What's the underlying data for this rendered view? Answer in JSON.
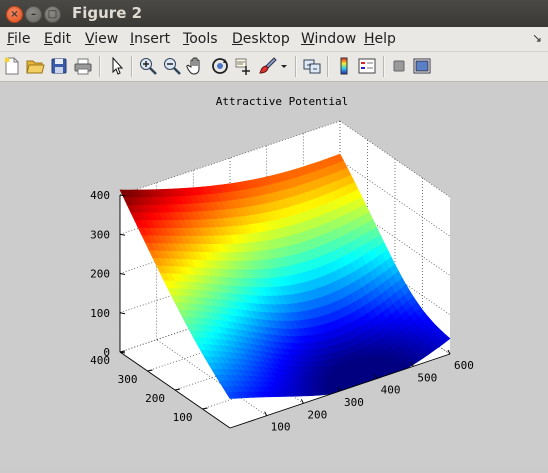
{
  "window": {
    "title": "Figure 2"
  },
  "menubar": {
    "items": [
      {
        "u": "F",
        "rest": "ile"
      },
      {
        "u": "E",
        "rest": "dit"
      },
      {
        "u": "V",
        "rest": "iew"
      },
      {
        "u": "I",
        "rest": "nsert"
      },
      {
        "u": "T",
        "rest": "ools"
      },
      {
        "u": "D",
        "rest": "esktop"
      },
      {
        "u": "W",
        "rest": "indow"
      },
      {
        "u": "H",
        "rest": "elp"
      }
    ],
    "dock_arrow": "↘"
  },
  "toolbar": {
    "icons": [
      "new-figure-icon",
      "open-file-icon",
      "save-icon",
      "print-icon",
      "edit-plot-arrow-icon",
      "zoom-in-icon",
      "zoom-out-icon",
      "pan-hand-icon",
      "rotate-3d-icon",
      "data-cursor-icon",
      "brush-icon",
      "brush-dropdown-icon",
      "link-plot-icon",
      "colorbar-icon",
      "legend-icon",
      "hide-plot-tools-icon",
      "show-plot-tools-icon"
    ]
  },
  "chart_data": {
    "type": "surface",
    "title": "Attractive Potential",
    "xlabel": "",
    "ylabel": "",
    "zlabel": "",
    "x_ticks": [
      100,
      200,
      300,
      400,
      500,
      600
    ],
    "y_ticks": [
      100,
      200,
      300,
      400
    ],
    "z_ticks": [
      0,
      100,
      200,
      300,
      400
    ],
    "xlim": [
      0,
      600
    ],
    "ylim": [
      0,
      400
    ],
    "zlim": [
      0,
      400
    ],
    "colormap": "jet",
    "grid": true,
    "corner_values": {
      "x0_y400": 400,
      "x0_y0": 50,
      "x600_y400": 330,
      "x600_y0": 90
    },
    "minimum_approx": {
      "x": 400,
      "y": 100,
      "z": 0
    }
  }
}
